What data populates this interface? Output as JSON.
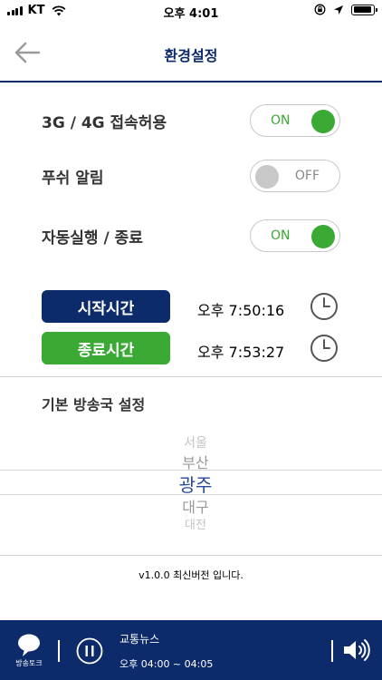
{
  "status_bar": {
    "carrier": "KT",
    "time": "오후 4:01",
    "battery_level": 0.95
  },
  "header": {
    "title": "환경설정",
    "back_icon": "arrow-left-icon"
  },
  "settings": {
    "network": {
      "label": "3G / 4G 접속허용",
      "state": "ON"
    },
    "push": {
      "label": "푸쉬 알림",
      "state": "OFF"
    },
    "autorun": {
      "label": "자동실행 / 종료",
      "state": "ON"
    }
  },
  "schedule": {
    "start": {
      "label": "시작시간",
      "time": "오후 7:50:16"
    },
    "end": {
      "label": "종료시간",
      "time": "오후 7:53:27"
    }
  },
  "station": {
    "title": "기본 방송국 설정",
    "options": [
      "서울",
      "부산",
      "광주",
      "대구",
      "대전"
    ],
    "selected": "광주"
  },
  "version_text": "v1.0.0 최신버전 입니다.",
  "player": {
    "talk_label": "방송토크",
    "program_name": "교통뉴스",
    "program_time": "오후 04:00 ~ 04:05"
  },
  "colors": {
    "brand_navy": "#0d2b6b",
    "accent_green": "#3aaa35",
    "toggle_off_gray": "#c8c8c8"
  }
}
